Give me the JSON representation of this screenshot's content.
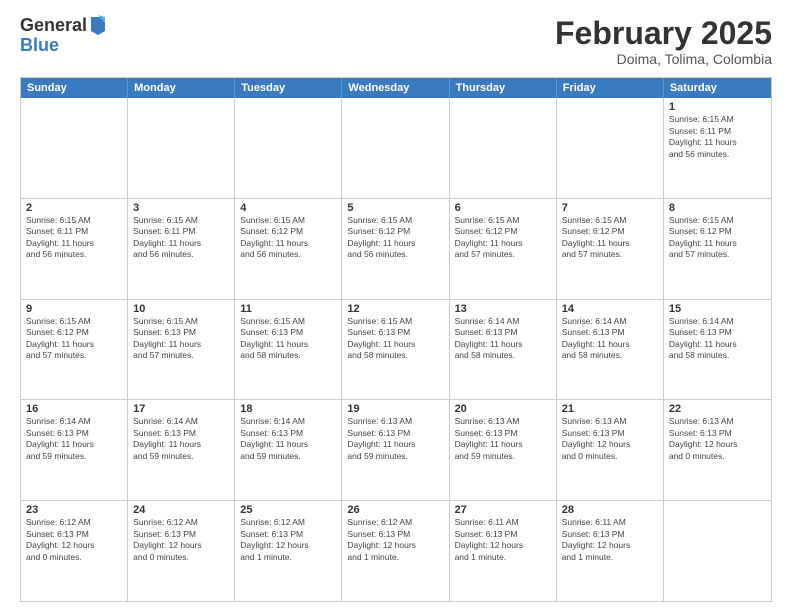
{
  "logo": {
    "general": "General",
    "blue": "Blue"
  },
  "header": {
    "month": "February 2025",
    "location": "Doima, Tolima, Colombia"
  },
  "weekdays": [
    "Sunday",
    "Monday",
    "Tuesday",
    "Wednesday",
    "Thursday",
    "Friday",
    "Saturday"
  ],
  "weeks": [
    [
      {
        "day": "",
        "info": ""
      },
      {
        "day": "",
        "info": ""
      },
      {
        "day": "",
        "info": ""
      },
      {
        "day": "",
        "info": ""
      },
      {
        "day": "",
        "info": ""
      },
      {
        "day": "",
        "info": ""
      },
      {
        "day": "1",
        "info": "Sunrise: 6:15 AM\nSunset: 6:11 PM\nDaylight: 11 hours\nand 56 minutes."
      }
    ],
    [
      {
        "day": "2",
        "info": "Sunrise: 6:15 AM\nSunset: 6:11 PM\nDaylight: 11 hours\nand 56 minutes."
      },
      {
        "day": "3",
        "info": "Sunrise: 6:15 AM\nSunset: 6:11 PM\nDaylight: 11 hours\nand 56 minutes."
      },
      {
        "day": "4",
        "info": "Sunrise: 6:15 AM\nSunset: 6:12 PM\nDaylight: 11 hours\nand 56 minutes."
      },
      {
        "day": "5",
        "info": "Sunrise: 6:15 AM\nSunset: 6:12 PM\nDaylight: 11 hours\nand 56 minutes."
      },
      {
        "day": "6",
        "info": "Sunrise: 6:15 AM\nSunset: 6:12 PM\nDaylight: 11 hours\nand 57 minutes."
      },
      {
        "day": "7",
        "info": "Sunrise: 6:15 AM\nSunset: 6:12 PM\nDaylight: 11 hours\nand 57 minutes."
      },
      {
        "day": "8",
        "info": "Sunrise: 6:15 AM\nSunset: 6:12 PM\nDaylight: 11 hours\nand 57 minutes."
      }
    ],
    [
      {
        "day": "9",
        "info": "Sunrise: 6:15 AM\nSunset: 6:12 PM\nDaylight: 11 hours\nand 57 minutes."
      },
      {
        "day": "10",
        "info": "Sunrise: 6:15 AM\nSunset: 6:13 PM\nDaylight: 11 hours\nand 57 minutes."
      },
      {
        "day": "11",
        "info": "Sunrise: 6:15 AM\nSunset: 6:13 PM\nDaylight: 11 hours\nand 58 minutes."
      },
      {
        "day": "12",
        "info": "Sunrise: 6:15 AM\nSunset: 6:13 PM\nDaylight: 11 hours\nand 58 minutes."
      },
      {
        "day": "13",
        "info": "Sunrise: 6:14 AM\nSunset: 6:13 PM\nDaylight: 11 hours\nand 58 minutes."
      },
      {
        "day": "14",
        "info": "Sunrise: 6:14 AM\nSunset: 6:13 PM\nDaylight: 11 hours\nand 58 minutes."
      },
      {
        "day": "15",
        "info": "Sunrise: 6:14 AM\nSunset: 6:13 PM\nDaylight: 11 hours\nand 58 minutes."
      }
    ],
    [
      {
        "day": "16",
        "info": "Sunrise: 6:14 AM\nSunset: 6:13 PM\nDaylight: 11 hours\nand 59 minutes."
      },
      {
        "day": "17",
        "info": "Sunrise: 6:14 AM\nSunset: 6:13 PM\nDaylight: 11 hours\nand 59 minutes."
      },
      {
        "day": "18",
        "info": "Sunrise: 6:14 AM\nSunset: 6:13 PM\nDaylight: 11 hours\nand 59 minutes."
      },
      {
        "day": "19",
        "info": "Sunrise: 6:13 AM\nSunset: 6:13 PM\nDaylight: 11 hours\nand 59 minutes."
      },
      {
        "day": "20",
        "info": "Sunrise: 6:13 AM\nSunset: 6:13 PM\nDaylight: 11 hours\nand 59 minutes."
      },
      {
        "day": "21",
        "info": "Sunrise: 6:13 AM\nSunset: 6:13 PM\nDaylight: 12 hours\nand 0 minutes."
      },
      {
        "day": "22",
        "info": "Sunrise: 6:13 AM\nSunset: 6:13 PM\nDaylight: 12 hours\nand 0 minutes."
      }
    ],
    [
      {
        "day": "23",
        "info": "Sunrise: 6:12 AM\nSunset: 6:13 PM\nDaylight: 12 hours\nand 0 minutes."
      },
      {
        "day": "24",
        "info": "Sunrise: 6:12 AM\nSunset: 6:13 PM\nDaylight: 12 hours\nand 0 minutes."
      },
      {
        "day": "25",
        "info": "Sunrise: 6:12 AM\nSunset: 6:13 PM\nDaylight: 12 hours\nand 1 minute."
      },
      {
        "day": "26",
        "info": "Sunrise: 6:12 AM\nSunset: 6:13 PM\nDaylight: 12 hours\nand 1 minute."
      },
      {
        "day": "27",
        "info": "Sunrise: 6:11 AM\nSunset: 6:13 PM\nDaylight: 12 hours\nand 1 minute."
      },
      {
        "day": "28",
        "info": "Sunrise: 6:11 AM\nSunset: 6:13 PM\nDaylight: 12 hours\nand 1 minute."
      },
      {
        "day": "",
        "info": ""
      }
    ]
  ]
}
